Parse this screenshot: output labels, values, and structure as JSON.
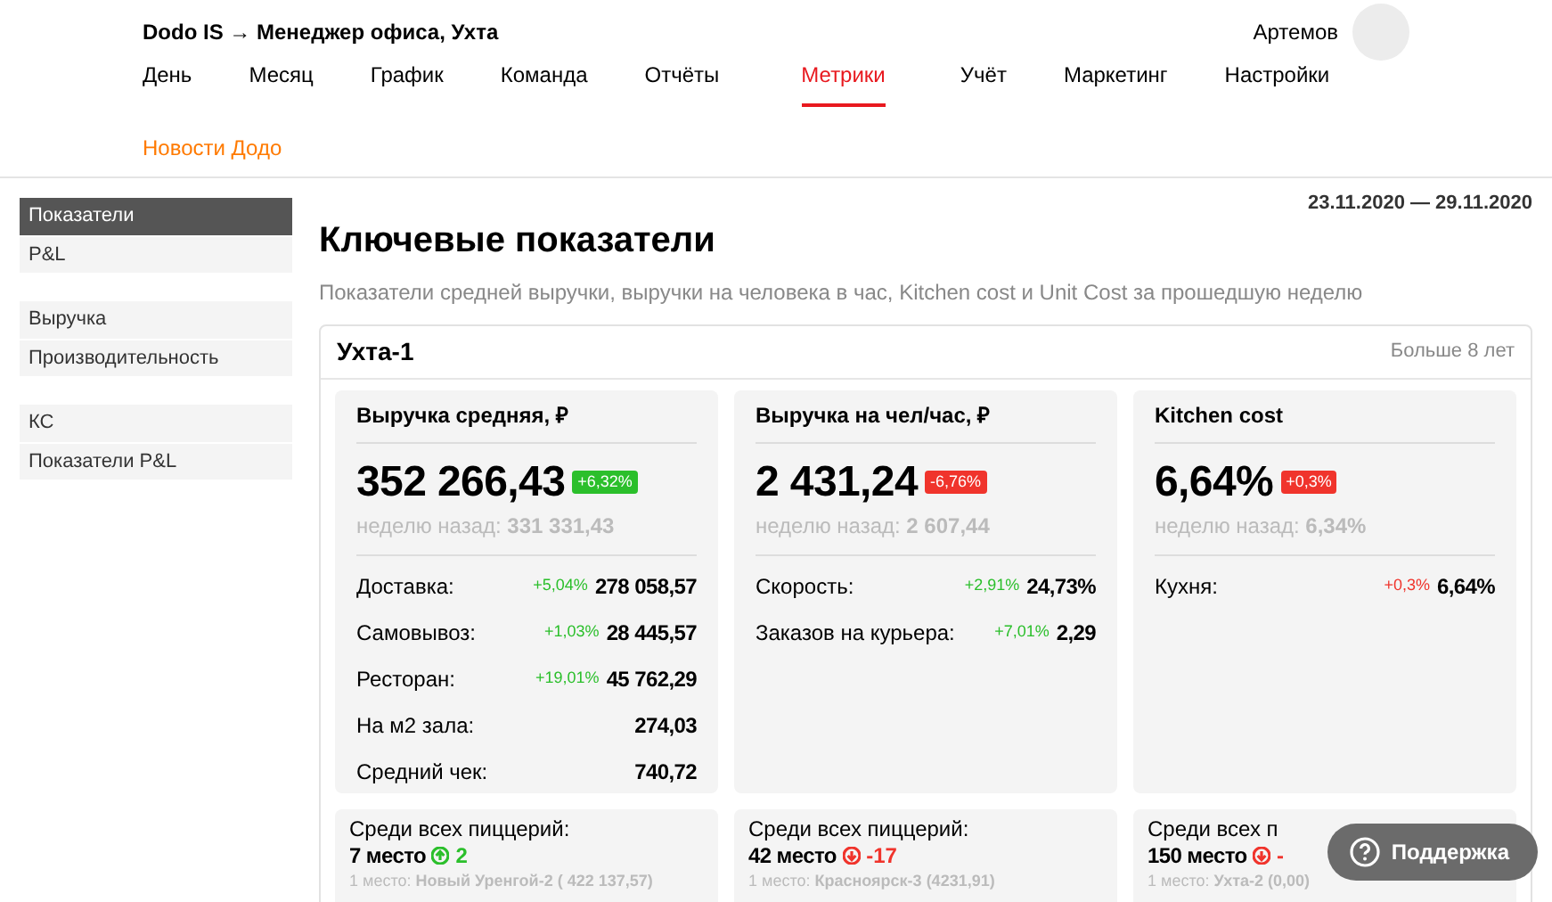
{
  "header": {
    "breadcrumb": "Dodo IS → Менеджер офиса, Ухта",
    "user": "Артемов"
  },
  "nav": [
    {
      "label": "День",
      "selected": false
    },
    {
      "label": "Месяц",
      "selected": false
    },
    {
      "label": "График",
      "selected": false
    },
    {
      "label": "Команда",
      "selected": false
    },
    {
      "label": "Отчёты",
      "selected": false
    },
    {
      "label": "Метрики",
      "selected": true
    },
    {
      "label": "Учёт",
      "selected": false
    },
    {
      "label": "Маркетинг",
      "selected": false
    },
    {
      "label": "Настройки",
      "selected": false
    }
  ],
  "news_link": "Новости Додо",
  "sidebar": {
    "groups": [
      {
        "items": [
          {
            "label": "Показатели",
            "selected": true
          },
          {
            "label": "P&L",
            "selected": false
          }
        ]
      },
      {
        "items": [
          {
            "label": "Выручка",
            "selected": false
          },
          {
            "label": "Производительность",
            "selected": false
          }
        ]
      },
      {
        "items": [
          {
            "label": "КС",
            "selected": false
          },
          {
            "label": "Показатели P&L",
            "selected": false
          }
        ]
      }
    ]
  },
  "date_range": "23.11.2020 — 29.11.2020",
  "page_title": "Ключевые показатели",
  "page_subtitle": "Показатели средней выручки, выручки на человека в час, Kitchen cost и Unit Cost за прошедшую неделю",
  "unit": {
    "name": "Ухта-1",
    "age": "Больше 8 лет",
    "metrics": [
      {
        "title": "Выручка средняя, ₽",
        "value": "352 266,43",
        "badge": {
          "text": "+6,32%",
          "positive": true
        },
        "prev_label": "неделю назад:",
        "prev_value": "331 331,43",
        "rows": [
          {
            "label": "Доставка:",
            "delta": "+5,04%",
            "positive": true,
            "value": "278 058,57"
          },
          {
            "label": "Самовывоз:",
            "delta": "+1,03%",
            "positive": true,
            "value": "28 445,57"
          },
          {
            "label": "Ресторан:",
            "delta": "+19,01%",
            "positive": true,
            "value": "45 762,29"
          },
          {
            "label": "На м2 зала:",
            "value": "274,03"
          },
          {
            "label": "Средний чек:",
            "value": "740,72"
          }
        ]
      },
      {
        "title": "Выручка на чел/час, ₽",
        "value": "2 431,24",
        "badge": {
          "text": "-6,76%",
          "positive": false
        },
        "prev_label": "неделю назад:",
        "prev_value": "2 607,44",
        "rows": [
          {
            "label": "Скорость:",
            "delta": "+2,91%",
            "positive": true,
            "value": "24,73%"
          },
          {
            "label": "Заказов на курьера:",
            "delta": "+7,01%",
            "positive": true,
            "value": "2,29"
          }
        ]
      },
      {
        "title": "Kitchen cost",
        "value": "6,64%",
        "badge": {
          "text": "+0,3%",
          "positive": false
        },
        "prev_label": "неделю назад:",
        "prev_value": "6,34%",
        "rows": [
          {
            "label": "Кухня:",
            "delta": "+0,3%",
            "positive": false,
            "value": "6,64%"
          }
        ]
      }
    ],
    "ranks": [
      {
        "label": "Среди всех пиццерий:",
        "place": "7 место",
        "rising": true,
        "change": "2",
        "leader_label": "1 место:",
        "leader": "Новый Уренгой-2 ( 422 137,57)"
      },
      {
        "label": "Среди всех пиццерий:",
        "place": "42 место",
        "rising": false,
        "change": "-17",
        "leader_label": "1 место:",
        "leader": "Красноярск-3 (4231,91)"
      },
      {
        "label": "Среди всех п",
        "place": "150 место",
        "rising": false,
        "change": "-",
        "leader_label": "1 место:",
        "leader": "Ухта-2 (0,00)"
      }
    ]
  },
  "support_button": "Поддержка"
}
